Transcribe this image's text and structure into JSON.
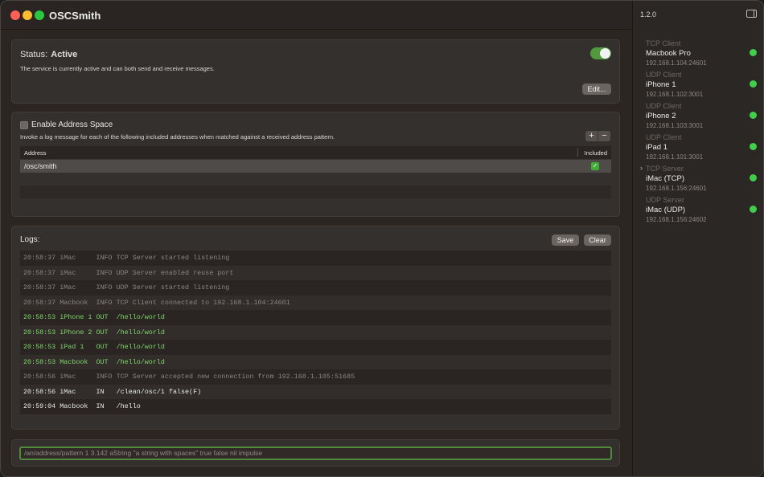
{
  "app": {
    "title": "OSCSmith"
  },
  "status": {
    "label": "Status:",
    "value": "Active",
    "description": "The service is currently active and can both send and receive messages.",
    "toggle_on": true,
    "edit_label": "Edit..."
  },
  "address_space": {
    "title": "Enable Address Space",
    "enabled": false,
    "description": "Invoke a log message for each of the following included addresses when matched against a received address pattern.",
    "add_label": "+",
    "remove_label": "−",
    "columns": {
      "address": "Address",
      "included": "Included"
    },
    "rows": [
      {
        "address": "/osc/smith",
        "included": true
      }
    ]
  },
  "logs": {
    "title": "Logs:",
    "save_label": "Save",
    "clear_label": "Clear",
    "entries": [
      {
        "text": "20:58:37 iMac     INFO TCP Server started listening",
        "style": "dim"
      },
      {
        "text": "20:58:37 iMac     INFO UDP Server enabled reuse port",
        "style": "dim"
      },
      {
        "text": "20:58:37 iMac     INFO UDP Server started listening",
        "style": "dim"
      },
      {
        "text": "20:58:37 Macbook  INFO TCP Client connected to 192.168.1.104:24601",
        "style": "dim"
      },
      {
        "text": "20:58:53 iPhone 1 OUT  /hello/world",
        "style": "green"
      },
      {
        "text": "20:58:53 iPhone 2 OUT  /hello/world",
        "style": "green"
      },
      {
        "text": "20:58:53 iPad 1   OUT  /hello/world",
        "style": "green"
      },
      {
        "text": "20:58:53 Macbook  OUT  /hello/world",
        "style": "green"
      },
      {
        "text": "20:58:56 iMac     INFO TCP Server accepted new connection from 192.168.1.105:51685",
        "style": "dim"
      },
      {
        "text": "20:58:56 iMac     IN   /clean/osc/1 false(F)",
        "style": "white"
      },
      {
        "text": "20:59:04 Macbook  IN   /hello",
        "style": "white"
      }
    ]
  },
  "command": {
    "placeholder": "/an/address/pattern 1 3.142 aString \"a string with spaces\" true false nil impulse"
  },
  "sidebar": {
    "version": "1.2.0",
    "connections": [
      {
        "type": "TCP Client",
        "name": "Macbook Pro",
        "address": "192.168.1.104:24601",
        "status_color": "#3fd04a",
        "selected": false
      },
      {
        "type": "UDP Client",
        "name": "iPhone 1",
        "address": "192.168.1.102:3001",
        "status_color": "#3fd04a",
        "selected": false
      },
      {
        "type": "UDP Client",
        "name": "iPhone 2",
        "address": "192.168.1.103:3001",
        "status_color": "#3fd04a",
        "selected": false
      },
      {
        "type": "UDP Client",
        "name": "iPad 1",
        "address": "192.168.1.101:3001",
        "status_color": "#3fd04a",
        "selected": false
      },
      {
        "type": "TCP Server",
        "name": "iMac (TCP)",
        "address": "192.168.1.156:24601",
        "status_color": "#3fd04a",
        "selected": true
      },
      {
        "type": "UDP Server",
        "name": "iMac (UDP)",
        "address": "192.168.1.156:24602",
        "status_color": "#3fd04a",
        "selected": false
      }
    ]
  }
}
